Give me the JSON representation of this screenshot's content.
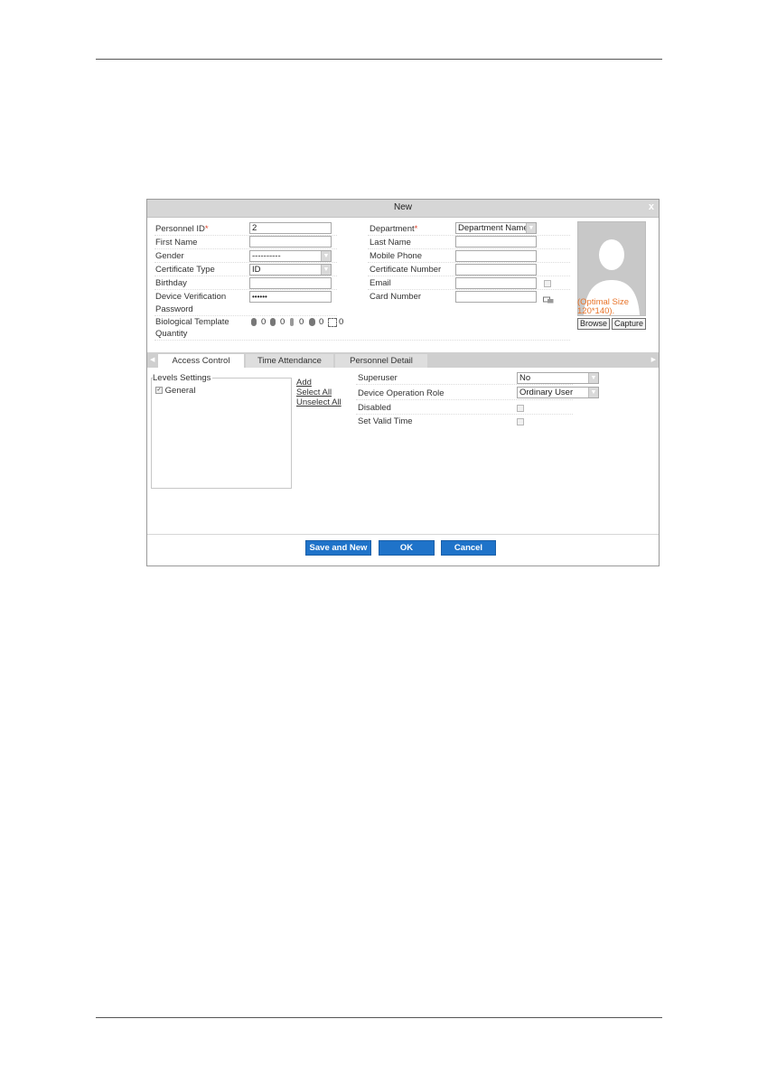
{
  "dialog": {
    "title": "New",
    "close_label": "x"
  },
  "form": {
    "personnel_id": {
      "label": "Personnel ID",
      "required_mark": "*",
      "value": "2"
    },
    "first_name": {
      "label": "First Name",
      "value": ""
    },
    "gender": {
      "label": "Gender",
      "value": "----------"
    },
    "certificate_type": {
      "label": "Certificate Type",
      "value": "ID"
    },
    "birthday": {
      "label": "Birthday",
      "value": ""
    },
    "device_verification": {
      "label_line1": "Device Verification",
      "label_line2": "Password",
      "value": "••••••"
    },
    "biological_template": {
      "label_line1": "Biological Template",
      "label_line2": "Quantity",
      "counts": [
        "0",
        "0",
        "0",
        "0",
        "0"
      ],
      "icons": [
        "fingerprint-icon",
        "finger-vein-icon",
        "palm-icon",
        "face-icon",
        "visible-face-icon"
      ]
    },
    "department": {
      "label": "Department",
      "required_mark": "*",
      "value": "Department Name"
    },
    "last_name": {
      "label": "Last Name",
      "value": ""
    },
    "mobile_phone": {
      "label": "Mobile Phone",
      "value": ""
    },
    "certificate_number": {
      "label": "Certificate Number",
      "value": ""
    },
    "email": {
      "label": "Email",
      "value": ""
    },
    "card_number": {
      "label": "Card Number",
      "value": ""
    }
  },
  "photo": {
    "hint_line1": "(Optimal Size",
    "hint_line2": "120*140).",
    "browse_label": "Browse",
    "capture_label": "Capture",
    "hint_color": "#e8742a"
  },
  "tabs": [
    {
      "label": "Access Control",
      "active": true
    },
    {
      "label": "Time Attendance",
      "active": false
    },
    {
      "label": "Personnel Detail",
      "active": false
    }
  ],
  "access_control": {
    "levels_settings_label": "Levels Settings",
    "levels": [
      {
        "label": "General",
        "checked": true
      }
    ],
    "links": {
      "add": "Add",
      "select_all": "Select All",
      "unselect_all": "Unselect All"
    },
    "superuser": {
      "label": "Superuser",
      "value": "No"
    },
    "device_operation_role": {
      "label": "Device Operation Role",
      "value": "Ordinary User"
    },
    "disabled": {
      "label": "Disabled",
      "checked": false
    },
    "set_valid_time": {
      "label": "Set Valid Time",
      "checked": false
    }
  },
  "footer": {
    "save_and_new": "Save and New",
    "ok": "OK",
    "cancel": "Cancel",
    "button_color": "#1f73c9"
  }
}
